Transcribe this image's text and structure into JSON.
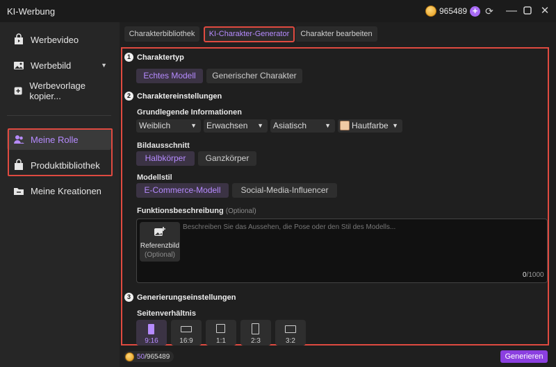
{
  "app": {
    "title": "KI-Werbung",
    "credits": "965489"
  },
  "sidebar": {
    "items": [
      {
        "label": "Werbevideo"
      },
      {
        "label": "Werbebild"
      },
      {
        "label": "Werbevorlage kopier..."
      },
      {
        "label": "Meine Rolle"
      },
      {
        "label": "Produktbibliothek"
      },
      {
        "label": "Meine Kreationen"
      }
    ]
  },
  "tabs": [
    {
      "label": "Charakterbibliothek"
    },
    {
      "label": "KI-Charakter-Generator"
    },
    {
      "label": "Charakter bearbeiten"
    }
  ],
  "section1": {
    "num": "1",
    "title": "Charaktertyp",
    "options": [
      "Echtes Modell",
      "Generischer Charakter"
    ]
  },
  "section2": {
    "num": "2",
    "title": "Charaktereinstellungen",
    "basic_info_title": "Grundlegende Informationen",
    "selects": [
      "Weiblich",
      "Erwachsen",
      "Asiatisch",
      "Hautfarbe"
    ],
    "crop_title": "Bildausschnitt",
    "crop_options": [
      "Halbkörper",
      "Ganzkörper"
    ],
    "style_title": "Modellstil",
    "style_options": [
      "E-Commerce-Modell",
      "Social-Media-Influencer"
    ],
    "desc_title": "Funktionsbeschreibung",
    "desc_optional": "(Optional)",
    "ref_label": "Referenzbild",
    "ref_optional": "(Optional)",
    "placeholder": "Beschreiben Sie das Aussehen, die Pose oder den Stil des Modells...",
    "counter_current": "0",
    "counter_max": "/1000"
  },
  "section3": {
    "num": "3",
    "title": "Generierungseinstellungen",
    "ratio_title": "Seitenverhältnis",
    "ratios": [
      "9:16",
      "16:9",
      "1:1",
      "2:3",
      "3:2"
    ]
  },
  "footer": {
    "used": "50",
    "total": "/965489",
    "generate_label": "Generieren"
  },
  "colors": {
    "accent": "#b68bff",
    "highlight": "#e04a40",
    "button": "#8b3fe0"
  }
}
